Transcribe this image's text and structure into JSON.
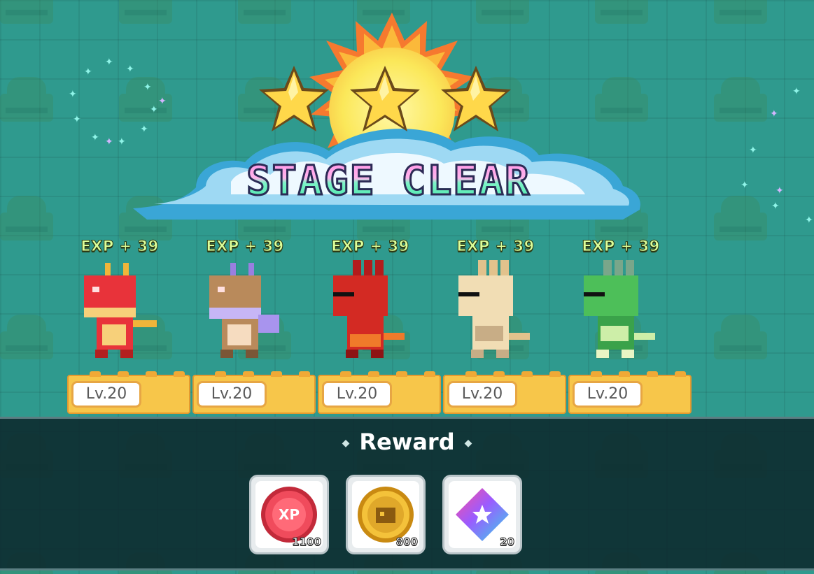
{
  "title": "STAGE CLEAR",
  "stars": 3,
  "characters": [
    {
      "exp": "EXP + 39",
      "level": "Lv.20",
      "color": "#e8333a"
    },
    {
      "exp": "EXP + 39",
      "level": "Lv.20",
      "color": "#b98a5b"
    },
    {
      "exp": "EXP + 39",
      "level": "Lv.20",
      "color": "#d32a23"
    },
    {
      "exp": "EXP + 39",
      "level": "Lv.20",
      "color": "#f1ddb4"
    },
    {
      "exp": "EXP + 39",
      "level": "Lv.20",
      "color": "#4dbf59"
    }
  ],
  "reward": {
    "heading": "Reward",
    "items": [
      {
        "name": "xp",
        "label": "XP",
        "quantity": "1100",
        "icon": "xp-icon"
      },
      {
        "name": "coin",
        "quantity": "800",
        "icon": "coin-icon"
      },
      {
        "name": "gem",
        "quantity": "20",
        "icon": "gem-icon"
      }
    ]
  },
  "colors": {
    "background": "#2f9a8e",
    "panel": "#0d282c",
    "level_bar": "#f7c64a"
  }
}
